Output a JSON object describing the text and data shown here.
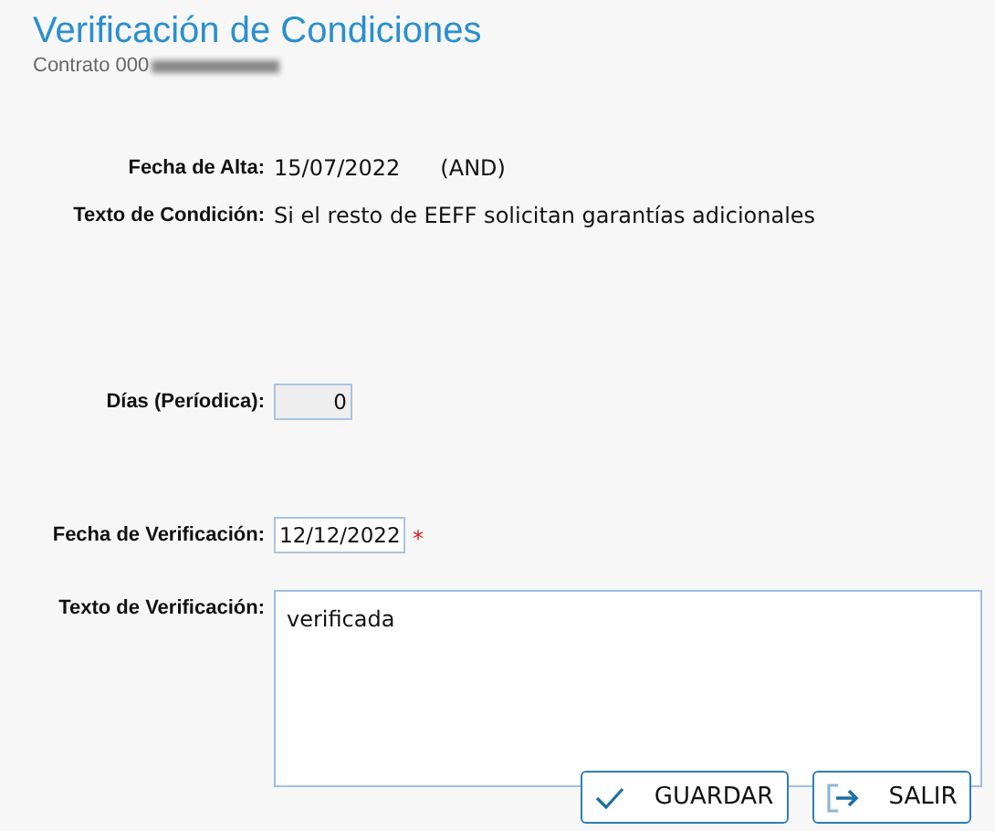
{
  "title": "Verificación de Condiciones",
  "subtitle": "Contrato 000",
  "subtitle_redacted": true,
  "fields": [
    {
      "kind": "text",
      "label": "Fecha de Alta:",
      "value": "15/07/2022",
      "extra": "(AND)"
    },
    {
      "kind": "text",
      "label": "Texto de Condición:",
      "value": "Si el resto de EEFF solicitan garantías adicionales"
    },
    {
      "kind": "input",
      "label": "Días (Períodica):",
      "value": "0",
      "disabled": true
    },
    {
      "kind": "input",
      "label": "Fecha de Verificación:",
      "value": "12/12/2022",
      "disabled": false,
      "required_mark": "*"
    },
    {
      "kind": "textarea",
      "label": "Texto de Verificación:",
      "value": "verificada"
    }
  ],
  "buttons": [
    {
      "kind": "save",
      "label": "GUARDAR"
    },
    {
      "kind": "exit",
      "label": "SALIR"
    }
  ]
}
